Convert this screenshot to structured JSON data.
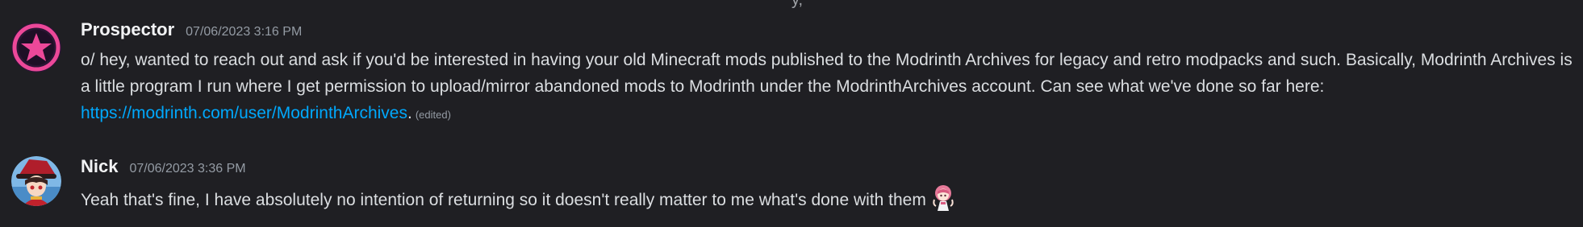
{
  "top_fragment": "y,",
  "messages": [
    {
      "username": "Prospector",
      "timestamp": "07/06/2023 3:16 PM",
      "text_before_link": "o/ hey, wanted to reach out and ask if you'd be interested in having your old Minecraft mods published to the Modrinth Archives for legacy and retro modpacks and such. Basically, Modrinth Archives is a little program I run where I get permission to upload/mirror abandoned mods to Modrinth under the ModrinthArchives account. Can see what we've done so far here: ",
      "link_text": "https://modrinth.com/user/ModrinthArchives",
      "text_after_link": ".",
      "edited_label": "(edited)",
      "avatar_icon": "modrinth-star-icon",
      "avatar_color": "#ec4899"
    },
    {
      "username": "Nick",
      "timestamp": "07/06/2023 3:36 PM",
      "text": "Yeah that's fine, I have absolutely no intention of returning so it doesn't really matter to me what's done with them",
      "avatar_icon": "anime-character-avatar",
      "emoji_icon": "anime-girl-emoji"
    }
  ],
  "colors": {
    "background": "#1f1f23",
    "username": "#f2f3f5",
    "timestamp": "#949ba4",
    "text": "#dbdee1",
    "link": "#00a8fc"
  }
}
